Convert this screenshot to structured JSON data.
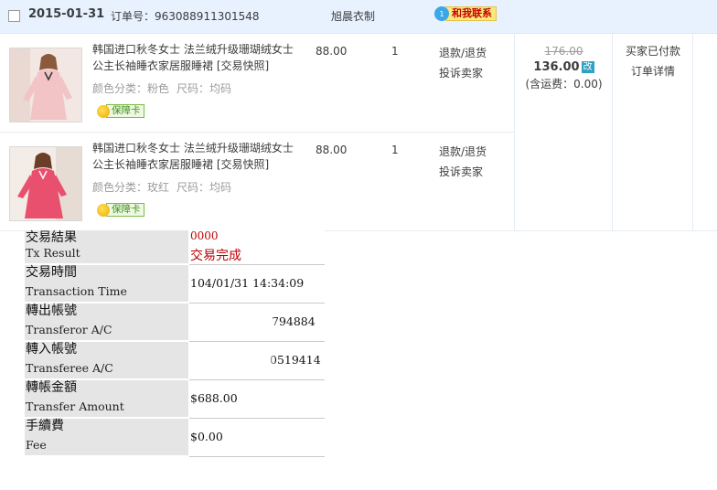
{
  "order": {
    "date": "2015-01-31",
    "order_no": "订单号：963088911301548",
    "shop": "旭晨衣制",
    "contact_label": "和我联系",
    "contact_badge": "1"
  },
  "items": [
    {
      "title": "韩国进口秋冬女士 法兰绒升级珊瑚绒女士公主长袖睡衣家居服睡裙 [交易快照]",
      "color": "颜色分类：粉色",
      "size": "尺码：均码",
      "guarantee": "保障卡",
      "price": "88.00",
      "qty": "1",
      "refund": "退款/退货",
      "complain": "投诉卖家",
      "thumb_color": "#f2c4c6"
    },
    {
      "title": "韩国进口秋冬女士 法兰绒升级珊瑚绒女士公主长袖睡衣家居服睡裙 [交易快照]",
      "color": "颜色分类：玫红",
      "size": "尺码：均码",
      "guarantee": "保障卡",
      "price": "88.00",
      "qty": "1",
      "refund": "退款/退货",
      "complain": "投诉卖家",
      "thumb_color": "#e8506e"
    }
  ],
  "total": {
    "old_price": "176.00",
    "price": "136.00",
    "modified_tag": "改",
    "shipping": "(含运费：0.00)"
  },
  "status": {
    "state": "买家已付款",
    "detail_link": "订单详情"
  },
  "receipt": [
    {
      "zh": "交易結果",
      "en": "Tx Result",
      "code": "0000",
      "value": "交易完成"
    },
    {
      "zh": "交易時間",
      "en": "Transaction Time",
      "value": "104/01/31 14:34:09"
    },
    {
      "zh": "轉出帳號",
      "en": "Transferor A/C",
      "value": "794884"
    },
    {
      "zh": "轉入帳號",
      "en": "Transferee A/C",
      "value": "0519414"
    },
    {
      "zh": "轉帳金額",
      "en": "Transfer Amount",
      "value": "$688.00"
    },
    {
      "zh": "手續費",
      "en": "Fee",
      "value": "$0.00"
    }
  ]
}
